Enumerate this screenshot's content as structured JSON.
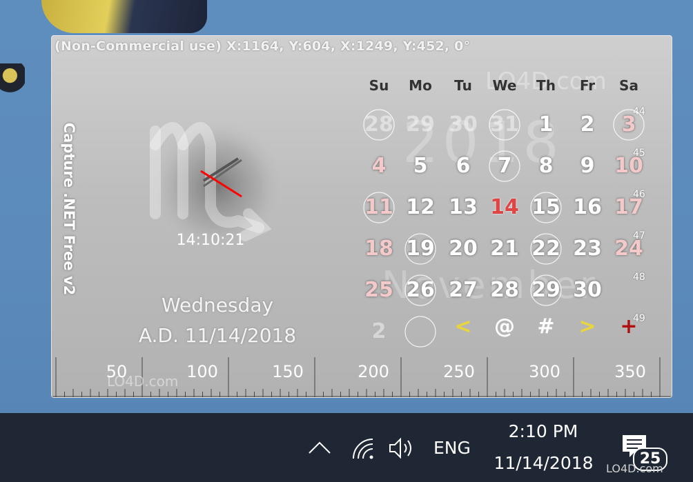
{
  "widget": {
    "status_text": "(Non-Commercial use) X:1164, Y:604, X:1249, Y:452, 0°",
    "vertical_title": "Capture .NET Free v2",
    "zodiac_icon": "scorpio-icon",
    "clock_time": "14:10:21",
    "day_name": "Wednesday",
    "date_line": "A.D. 11/14/2018",
    "calendar": {
      "watermark": "LO4D.com",
      "year_watermark": "2018",
      "month_watermark": "November",
      "weekdays": [
        "Su",
        "Mo",
        "Tu",
        "We",
        "Th",
        "Fr",
        "Sa"
      ],
      "weeks": [
        {
          "week_no": "44",
          "days": [
            "28",
            "29",
            "30",
            "31",
            "1",
            "2",
            "3"
          ]
        },
        {
          "week_no": "45",
          "days": [
            "4",
            "5",
            "6",
            "7",
            "8",
            "9",
            "10"
          ]
        },
        {
          "week_no": "46",
          "days": [
            "11",
            "12",
            "13",
            "14",
            "15",
            "16",
            "17"
          ]
        },
        {
          "week_no": "47",
          "days": [
            "18",
            "19",
            "20",
            "21",
            "22",
            "23",
            "24"
          ]
        },
        {
          "week_no": "48",
          "days": [
            "25",
            "26",
            "27",
            "28",
            "29",
            "30",
            ""
          ]
        },
        {
          "week_no": "49",
          "days": [
            "2",
            "",
            "",
            "",
            "",
            "",
            ""
          ]
        }
      ],
      "nav": {
        "prev": "<",
        "today": "@",
        "week": "#",
        "next": ">",
        "add": "+"
      }
    },
    "ruler": {
      "labels": [
        "50",
        "100",
        "150",
        "200",
        "250",
        "300",
        "350"
      ],
      "watermark": "LO4D.com"
    }
  },
  "taskbar": {
    "chevron_icon": "chevron-up-icon",
    "network_icon": "wifi-icon",
    "volume_icon": "speaker-icon",
    "language": "ENG",
    "time": "2:10 PM",
    "date": "11/14/2018",
    "notifications_count": "25"
  },
  "brand": "LO4D.com"
}
